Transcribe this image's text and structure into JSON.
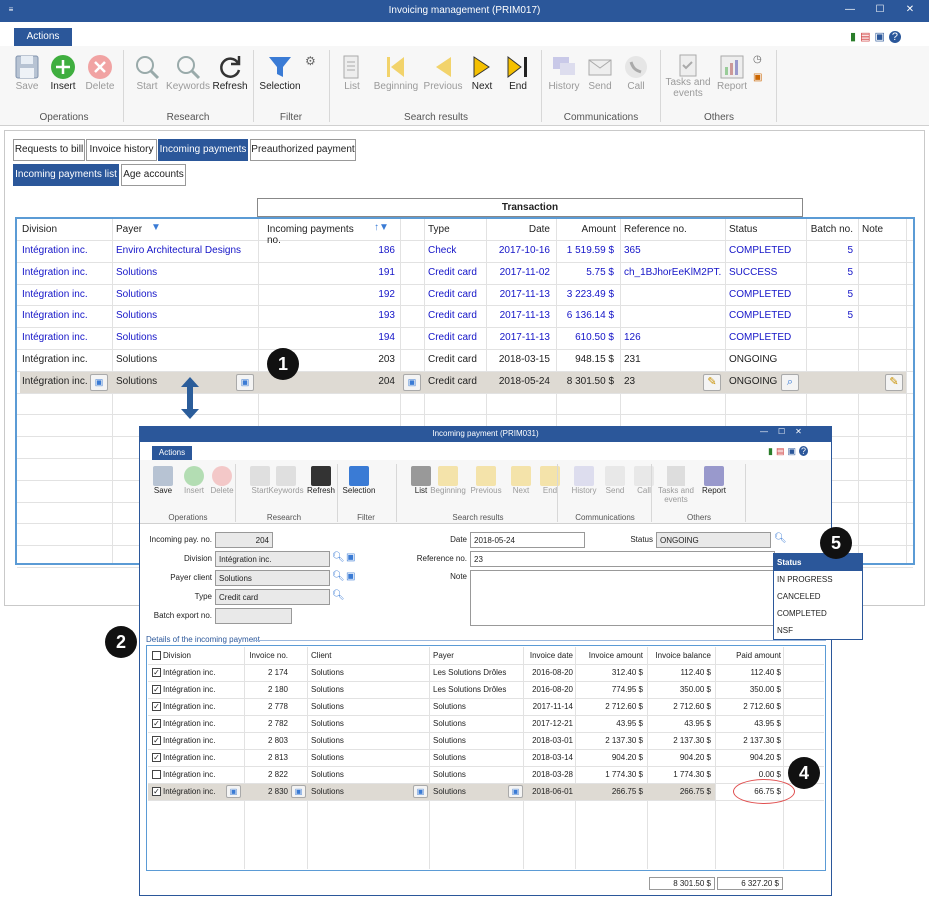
{
  "main_window": {
    "title": "Invoicing management (PRIM017)",
    "ribbon_tab": "Actions",
    "buttons": {
      "save": "Save",
      "insert": "Insert",
      "delete": "Delete",
      "start": "Start",
      "keywords": "Keywords",
      "refresh": "Refresh",
      "selection": "Selection",
      "list": "List",
      "beginning": "Beginning",
      "previous": "Previous",
      "next": "Next",
      "end": "End",
      "history": "History",
      "send": "Send",
      "call": "Call",
      "tasks_events_1": "Tasks and",
      "tasks_events_2": "events",
      "report": "Report"
    },
    "groups": {
      "operations": "Operations",
      "research": "Research",
      "filter": "Filter",
      "search_results": "Search results",
      "communications": "Communications",
      "others": "Others"
    },
    "tabs": [
      "Requests to bill",
      "Invoice history",
      "Incoming payments",
      "Preauthorized payment"
    ],
    "subtabs": [
      "Incoming payments list",
      "Age accounts"
    ],
    "transaction_header": "Transaction",
    "columns": [
      "Division",
      "Payer",
      "Incoming payments no.",
      "Type",
      "Date",
      "Amount",
      "Reference no.",
      "Status",
      "Batch no.",
      "Note"
    ],
    "rows": [
      {
        "division": "Intégration inc.",
        "payer": "Enviro Architectural Designs",
        "no": "186",
        "type": "Check",
        "date": "2017-10-16",
        "amount": "1 519.59 $",
        "ref": "365",
        "status": "COMPLETED",
        "batch": "5",
        "blue": true
      },
      {
        "division": "Intégration inc.",
        "payer": "Solutions",
        "no": "191",
        "type": "Credit card",
        "date": "2017-11-02",
        "amount": "5.75 $",
        "ref": "ch_1BJhorEeKlM2PT...",
        "status": "SUCCESS",
        "batch": "5",
        "blue": true
      },
      {
        "division": "Intégration inc.",
        "payer": "Solutions",
        "no": "192",
        "type": "Credit card",
        "date": "2017-11-13",
        "amount": "3 223.49 $",
        "ref": "",
        "status": "COMPLETED",
        "batch": "5",
        "blue": true
      },
      {
        "division": "Intégration inc.",
        "payer": "Solutions",
        "no": "193",
        "type": "Credit card",
        "date": "2017-11-13",
        "amount": "6 136.14 $",
        "ref": "",
        "status": "COMPLETED",
        "batch": "5",
        "blue": true
      },
      {
        "division": "Intégration inc.",
        "payer": "Solutions",
        "no": "194",
        "type": "Credit card",
        "date": "2017-11-13",
        "amount": "610.50 $",
        "ref": "126",
        "status": "COMPLETED",
        "batch": "",
        "blue": true
      },
      {
        "division": "Intégration inc.",
        "payer": "Solutions",
        "no": "203",
        "type": "Credit card",
        "date": "2018-03-15",
        "amount": "948.15 $",
        "ref": "231",
        "status": "ONGOING",
        "batch": "",
        "blue": false
      },
      {
        "division": "Intégration inc.",
        "payer": "Solutions",
        "no": "204",
        "type": "Credit card",
        "date": "2018-05-24",
        "amount": "8 301.50 $",
        "ref": "23",
        "status": "ONGOING",
        "batch": "",
        "blue": false,
        "selected": true
      }
    ]
  },
  "dialog": {
    "title": "Incoming payment (PRIM031)",
    "ribbon_tab": "Actions",
    "buttons": {
      "save": "Save",
      "insert": "Insert",
      "delete": "Delete",
      "start": "Start",
      "keywords": "Keywords",
      "refresh": "Refresh",
      "selection": "Selection",
      "list": "List",
      "beginning": "Beginning",
      "previous": "Previous",
      "next": "Next",
      "end": "End",
      "history": "History",
      "send": "Send",
      "call": "Call",
      "tasks_events_1": "Tasks and",
      "tasks_events_2": "events",
      "report": "Report"
    },
    "groups": {
      "operations": "Operations",
      "research": "Research",
      "filter": "Filter",
      "search_results": "Search results",
      "communications": "Communications",
      "others": "Others"
    },
    "form": {
      "pay_no_label": "Incoming pay. no.",
      "pay_no": "204",
      "division_label": "Division",
      "division": "Intégration inc.",
      "payer_label": "Payer client",
      "payer": "Solutions",
      "type_label": "Type",
      "type": "Credit card",
      "batch_label": "Batch export no.",
      "batch": "",
      "date_label": "Date",
      "date": "2018-05-24",
      "ref_label": "Reference no.",
      "ref": "23",
      "note_label": "Note",
      "note": "",
      "status_label": "Status",
      "status": "ONGOING"
    },
    "status_options_header": "Status",
    "status_options": [
      "IN PROGRESS",
      "CANCELED",
      "COMPLETED",
      "NSF"
    ],
    "details_label": "Details of the incoming payment",
    "detail_columns": [
      "Division",
      "Invoice no.",
      "Client",
      "Payer",
      "Invoice date",
      "Invoice amount",
      "Invoice balance",
      "Paid amount"
    ],
    "detail_rows": [
      {
        "checked": true,
        "division": "Intégration inc.",
        "invoice": "2 174",
        "client": "Solutions",
        "payer": "Les Solutions Drôles",
        "date": "2016-08-20",
        "amount": "312.40 $",
        "balance": "112.40 $",
        "paid": "112.40 $"
      },
      {
        "checked": true,
        "division": "Intégration inc.",
        "invoice": "2 180",
        "client": "Solutions",
        "payer": "Les Solutions Drôles",
        "date": "2016-08-20",
        "amount": "774.95 $",
        "balance": "350.00 $",
        "paid": "350.00 $"
      },
      {
        "checked": true,
        "division": "Intégration inc.",
        "invoice": "2 778",
        "client": "Solutions",
        "payer": "Solutions",
        "date": "2017-11-14",
        "amount": "2 712.60 $",
        "balance": "2 712.60 $",
        "paid": "2 712.60 $"
      },
      {
        "checked": true,
        "division": "Intégration inc.",
        "invoice": "2 782",
        "client": "Solutions",
        "payer": "Solutions",
        "date": "2017-12-21",
        "amount": "43.95 $",
        "balance": "43.95 $",
        "paid": "43.95 $"
      },
      {
        "checked": true,
        "division": "Intégration inc.",
        "invoice": "2 803",
        "client": "Solutions",
        "payer": "Solutions",
        "date": "2018-03-01",
        "amount": "2 137.30 $",
        "balance": "2 137.30 $",
        "paid": "2 137.30 $"
      },
      {
        "checked": true,
        "division": "Intégration inc.",
        "invoice": "2 813",
        "client": "Solutions",
        "payer": "Solutions",
        "date": "2018-03-14",
        "amount": "904.20 $",
        "balance": "904.20 $",
        "paid": "904.20 $"
      },
      {
        "checked": false,
        "division": "Intégration inc.",
        "invoice": "2 822",
        "client": "Solutions",
        "payer": "Solutions",
        "date": "2018-03-28",
        "amount": "1 774.30 $",
        "balance": "1 774.30 $",
        "paid": "0.00 $"
      },
      {
        "checked": true,
        "division": "Intégration inc.",
        "invoice": "2 830",
        "client": "Solutions",
        "payer": "Solutions",
        "date": "2018-06-01",
        "amount": "266.75 $",
        "balance": "266.75 $",
        "paid": "66.75 $",
        "selected": true
      }
    ],
    "total_balance": "8 301.50 $",
    "total_paid": "6 327.20 $"
  },
  "callouts": [
    "1",
    "2",
    "4",
    "5"
  ],
  "colors": {
    "accent": "#2b579a",
    "grid_border": "#5b9bd5",
    "link_text": "#1515c8",
    "selected_row": "#dedad3",
    "highlight_circle": "#e05050"
  }
}
